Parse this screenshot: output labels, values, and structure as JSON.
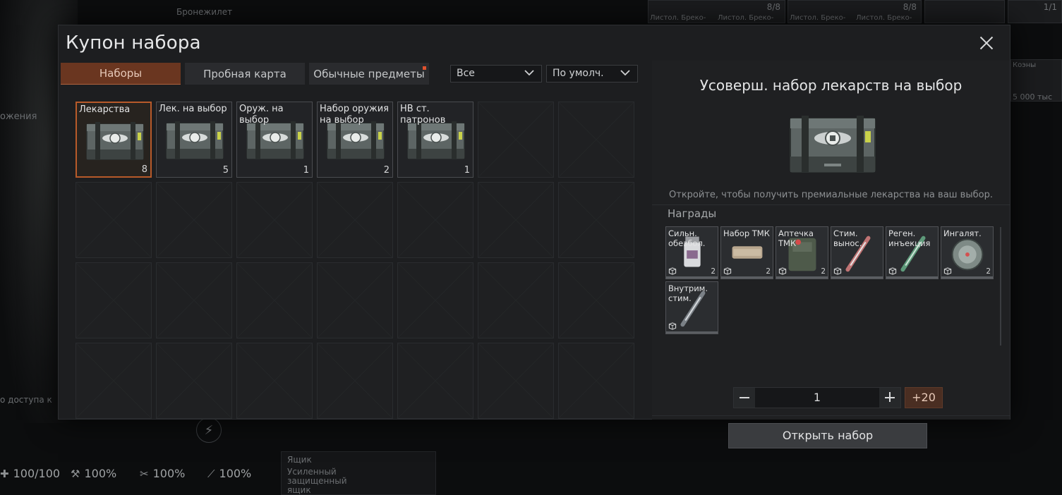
{
  "background": {
    "armor_label": "Бронежилет",
    "left_label": "ожения",
    "access_label": "о доступа к",
    "slot_counts": [
      "8/8",
      "8/8",
      "1/1"
    ],
    "pistol_labels": [
      "Листол. Бреко-",
      "Листол. Бреко-",
      "Листол. Бреко-",
      "Листол. Бреко-"
    ],
    "right_item_label": "Коэны",
    "right_item_price": "5 000 тыс",
    "stats": [
      "100/100",
      "100%",
      "100%",
      "100%"
    ],
    "crate_label": "Ящик",
    "crate_desc": "Усиленный защищенный ящик"
  },
  "modal": {
    "title": "Купон набора",
    "tabs": [
      {
        "label": "Наборы",
        "active": true
      },
      {
        "label": "Пробная карта",
        "active": false
      },
      {
        "label": "Обычные предметы",
        "active": false,
        "has_notification": true
      }
    ],
    "filters": {
      "category": "Все",
      "sort": "По умолч."
    },
    "kits": [
      {
        "name": "Лекарства",
        "qty": "8",
        "selected": true
      },
      {
        "name": "Лек. на выбор",
        "qty": "5",
        "selected": false
      },
      {
        "name": "Оруж. на выбор",
        "qty": "1",
        "selected": false
      },
      {
        "name": "Набор оружия на выбор",
        "qty": "2",
        "selected": false
      },
      {
        "name": "НВ ст. патронов",
        "qty": "1",
        "selected": false
      }
    ],
    "detail": {
      "title": "Усоверш. набор лекарств на выбор",
      "description": "Откройте, чтобы получить премиальные лекарства на ваш выбор.",
      "rewards_label": "Награды",
      "rewards": [
        {
          "name": "Сильн. обезбол.",
          "qty": "2",
          "icon": "painkiller-bottle-icon"
        },
        {
          "name": "Набор ТМК",
          "qty": "2",
          "icon": "bandage-pack-icon"
        },
        {
          "name": "Аптечка ТМК",
          "qty": "2",
          "icon": "medkit-pouch-icon"
        },
        {
          "name": "Стим. вынос.",
          "qty": "",
          "icon": "stim-syringe-icon"
        },
        {
          "name": "Реген. инъекция",
          "qty": "",
          "icon": "regen-injector-icon"
        },
        {
          "name": "Ингалят.",
          "qty": "2",
          "icon": "inhaler-canister-icon"
        },
        {
          "name": "Внутрим. стим.",
          "qty": "",
          "icon": "auto-injector-icon"
        }
      ],
      "quantity": "1",
      "plus_label": "+20",
      "open_button": "Открыть набор"
    },
    "accent_color": "#b85a2a"
  }
}
